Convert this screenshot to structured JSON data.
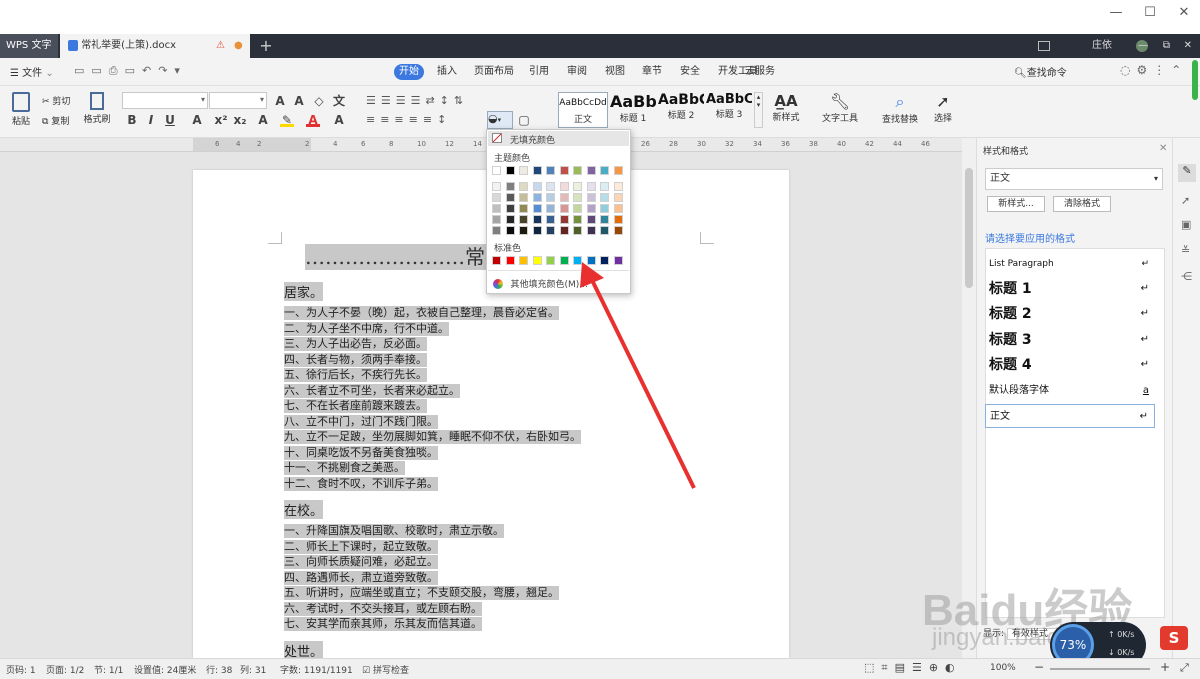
{
  "window": {
    "controls": [
      "—",
      "☐",
      "✕"
    ]
  },
  "tabs": {
    "app": "WPS 文字",
    "doc": "常礼举要(上策).docx",
    "add": "+",
    "user": "庄依"
  },
  "menu": {
    "file": "文件",
    "items": [
      "开始",
      "插入",
      "页面布局",
      "引用",
      "审阅",
      "视图",
      "章节",
      "安全",
      "开发工具",
      "云服务"
    ],
    "active": "开始",
    "search": "查找命令"
  },
  "ribbon": {
    "paste": "粘贴",
    "cut": "剪切",
    "copy": "复制",
    "format_painter": "格式刷",
    "styles": [
      {
        "sample": "AaBbCcDd",
        "label": "正文"
      },
      {
        "sample": "AaBb",
        "label": "标题 1"
      },
      {
        "sample": "AaBbC",
        "label": "标题 2"
      },
      {
        "sample": "AaBbC",
        "label": "标题 3"
      }
    ],
    "new_style": "新样式",
    "text_tools": "文字工具",
    "find_replace": "查找替换",
    "select": "选择"
  },
  "ruler": {
    "ticks": [
      "6",
      "4",
      "2",
      "2",
      "4",
      "6",
      "8",
      "10",
      "12",
      "14",
      "16",
      "18",
      "20",
      "22",
      "24",
      "26",
      "28",
      "30",
      "32",
      "34",
      "36",
      "38",
      "40",
      "42",
      "44",
      "46"
    ]
  },
  "popup": {
    "no_fill": "无填充颜色",
    "theme_colors_title": "主题颜色",
    "standard_colors_title": "标准色",
    "more_colors": "其他填充颜色(M)...",
    "theme_top": [
      "#ffffff",
      "#000000",
      "#eeece1",
      "#1f497d",
      "#4f81bd",
      "#c0504d",
      "#9bbb59",
      "#8064a2",
      "#4bacc6",
      "#f79646"
    ],
    "theme_grid": [
      [
        "#f2f2f2",
        "#7f7f7f",
        "#ddd9c3",
        "#c6d9f0",
        "#dbe5f1",
        "#f2dcdb",
        "#ebf1dd",
        "#e5e0ec",
        "#dbeef3",
        "#fdeada"
      ],
      [
        "#d8d8d8",
        "#595959",
        "#c4bd97",
        "#8db3e2",
        "#b8cce4",
        "#e5b9b7",
        "#d7e3bc",
        "#ccc1d9",
        "#b7dde8",
        "#fbd5b5"
      ],
      [
        "#bfbfbf",
        "#3f3f3f",
        "#938953",
        "#548dd4",
        "#95b3d7",
        "#d99694",
        "#c3d69b",
        "#b2a2c7",
        "#92cddc",
        "#fac08f"
      ],
      [
        "#a5a5a5",
        "#262626",
        "#494429",
        "#17365d",
        "#366092",
        "#953734",
        "#76923c",
        "#5f497a",
        "#31859b",
        "#e36c09"
      ],
      [
        "#7f7f7f",
        "#0c0c0c",
        "#1d1b10",
        "#0f243e",
        "#244061",
        "#632423",
        "#4f6128",
        "#3f3151",
        "#205867",
        "#974806"
      ]
    ],
    "standard": [
      "#c00000",
      "#ff0000",
      "#ffc000",
      "#ffff00",
      "#92d050",
      "#00b050",
      "#00b0f0",
      "#0070c0",
      "#002060",
      "#7030a0"
    ]
  },
  "document": {
    "title": "……………………常礼举",
    "sections": [
      {
        "heading": "居家。",
        "lines": [
          "一、为人子不晏（晚）起，衣被自己整理，晨昏必定省。",
          "二、为人子坐不中席，行不中道。",
          "三、为人子出必告，反必面。",
          "四、长者与物，须两手奉接。",
          "五、徐行后长，不疾行先长。",
          "六、长者立不可坐，长者来必起立。",
          "七、不在长者座前踱来踱去。",
          "八、立不中门，过门不践门限。",
          "九、立不一足跛，坐勿展脚如箕，睡眠不仰不伏，右卧如弓。",
          "十、同桌吃饭不另备美食独啖。",
          "十一、不挑剔食之美恶。",
          "十二、食时不叹，不训斥子弟。"
        ]
      },
      {
        "heading": "在校。",
        "lines": [
          "一、升降国旗及唱国歌、校歌时，肃立示敬。",
          "二、师长上下课时，起立致敬。",
          "三、向师长质疑问难，必起立。",
          "四、路遇师长，肃立道旁致敬。",
          "五、听讲时，应端坐或直立；不支颐交股，弯腰，翘足。",
          "六、考试时，不交头接耳，或左顾右盼。",
          "七、安其学而亲其师，乐其友而信其道。"
        ]
      },
      {
        "heading": "处世。",
        "lines": []
      }
    ]
  },
  "panel": {
    "title": "样式和格式",
    "current": "正文",
    "new_style": "新样式...",
    "clear_format": "清除格式",
    "apply_label": "请选择要应用的格式",
    "list": [
      "List Paragraph",
      "标题  1",
      "标题  2",
      "标题  3",
      "标题  4",
      "默认段落字体",
      "正文"
    ],
    "show_label": "显示:",
    "show_value": "有效样式"
  },
  "status": {
    "page_num": "页码: 1",
    "pages": "页面: 1/2",
    "section": "节: 1/1",
    "setting": "设置值: 24厘米",
    "row": "行: 38",
    "col": "列: 31",
    "words": "字数: 1191/1191",
    "spell": "拼写检查",
    "zoom": "100%"
  },
  "widget": {
    "percent": "73%",
    "up": "0K/s",
    "down": "0K/s"
  },
  "watermark": {
    "brand": "Baidu经验",
    "url": "jingyan.baidu.com"
  },
  "colors": {
    "accent": "#3b79e0",
    "highlight": "#c8c8c8",
    "arrow": "#e8312f"
  }
}
